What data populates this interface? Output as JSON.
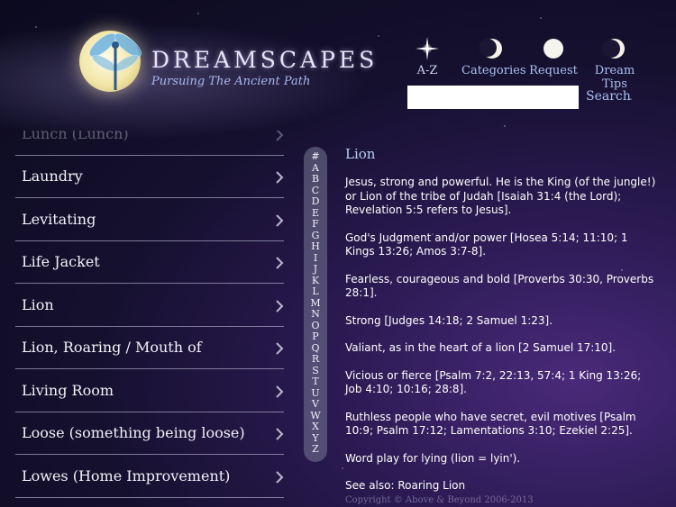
{
  "app": {
    "title": "DREAMSCAPES",
    "subtitle": "Pursuing The Ancient Path"
  },
  "nav": [
    {
      "label": "A-Z",
      "icon": "star-icon"
    },
    {
      "label": "Categories",
      "icon": "crescent-moon-icon"
    },
    {
      "label": "Request",
      "icon": "full-moon-icon"
    },
    {
      "label": "Dream Tips",
      "icon": "waning-moon-icon"
    }
  ],
  "search": {
    "value": "",
    "button_label": "Search"
  },
  "list": {
    "partial_item": "Lunch (Lunch)",
    "items": [
      "Laundry",
      "Levitating",
      "Life Jacket",
      "Lion",
      "Lion, Roaring / Mouth of",
      "Living Room",
      "Loose (something being loose)",
      "Lowes (Home Improvement)"
    ]
  },
  "alphabet": [
    "#",
    "A",
    "B",
    "C",
    "D",
    "E",
    "F",
    "G",
    "H",
    "I",
    "J",
    "K",
    "L",
    "M",
    "N",
    "O",
    "P",
    "Q",
    "R",
    "S",
    "T",
    "U",
    "V",
    "W",
    "X",
    "Y",
    "Z"
  ],
  "detail": {
    "title": "Lion",
    "paragraphs": [
      "Jesus, strong and powerful. He is the King (of the jungle!) or Lion of the tribe of Judah [Isaiah 31:4 (the Lord); Revelation 5:5 refers to Jesus].",
      "God's Judgment and/or power [Hosea 5:14; 11:10; 1 Kings 13:26; Amos 3:7-8].",
      "Fearless, courageous and bold [Proverbs 30:30, Proverbs 28:1].",
      "Strong [Judges 14:18; 2 Samuel 1:23].",
      "Valiant, as in the heart of a lion [2 Samuel 17:10].",
      "Vicious or fierce [Psalm 7:2, 22:13, 57:4; 1 King 13:26; Job 4:10; 10:16; 28:8].",
      "Ruthless people who have secret, evil motives [Psalm 10:9; Psalm 17:12; Lamentations 3:10; Ezekiel 2:25].",
      "Word play for lying (lion = lyin').",
      "See also: Roaring Lion"
    ],
    "copyright": "Copyright © Above & Beyond 2006-2013"
  }
}
